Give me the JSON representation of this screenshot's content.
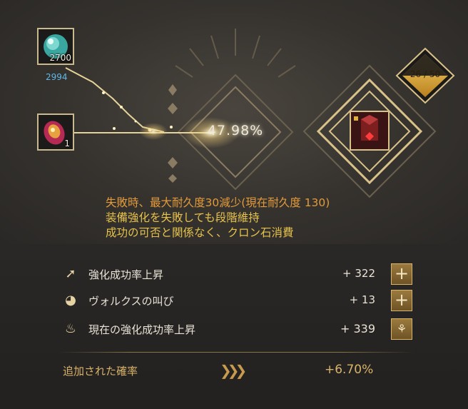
{
  "materials": [
    {
      "name": "blackstone",
      "slot_count": "2700",
      "owned_count": "2994"
    },
    {
      "name": "cron-stone",
      "slot_count": "1"
    }
  ],
  "enhance": {
    "success_rate": "47.98%",
    "progress": "26 / 50"
  },
  "warning": {
    "line1": "失敗時、最大耐久度30減少(現在耐久度 130)",
    "line2": "装備強化を失敗しても段階維持",
    "line3": "成功の可否と関係なく、クロン石消費"
  },
  "stats": [
    {
      "label": "強化成功率上昇",
      "value": "+ 322",
      "icon": "arrow-up-icon"
    },
    {
      "label": "ヴォルクスの叫び",
      "value": "+ 13",
      "icon": "valks-cry-icon"
    },
    {
      "label": "現在の強化成功率上昇",
      "value": "+ 339",
      "icon": "flame-icon"
    }
  ],
  "added": {
    "label": "追加された確率",
    "value": "+6.70%"
  },
  "colors": {
    "accent": "#d8b36a",
    "warning_orange": "#e39a3a",
    "warning_yellow": "#e6c24a",
    "owned_blue": "#5fb8e6"
  }
}
